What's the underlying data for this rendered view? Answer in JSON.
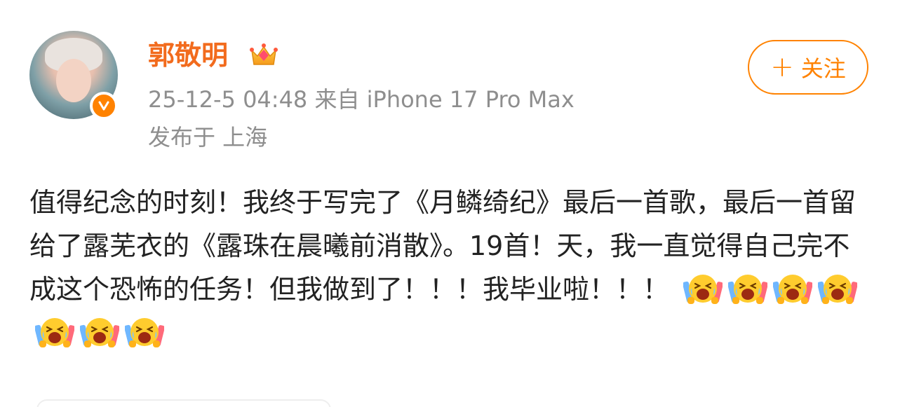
{
  "post": {
    "author": "郭敬明",
    "meta": "25-12-5 04:48  来自 iPhone 17 Pro Max",
    "location": "发布于 上海",
    "follow_label": "关注",
    "content_text": "值得纪念的时刻！我终于写完了《月鳞绮纪》最后一首歌，最后一首留给了露芜衣的《露珠在晨曦前消散》。19首！天，我一直觉得自己完不成这个恐怖的任务！但我做到了！！！我毕业啦！！！",
    "emoji_count": 7
  },
  "icons": {
    "avatar": "avatar-photo",
    "verified": "orange-v-badge-icon",
    "crown": "crown-membership-icon",
    "follow_plus": "plus-icon",
    "emoji": "laughing-crying-glowstick-emoji-icon"
  },
  "colors": {
    "accent": "#ff8200",
    "username": "#f26b1d",
    "meta_text": "#8e8e8e",
    "body_text": "#222222"
  }
}
